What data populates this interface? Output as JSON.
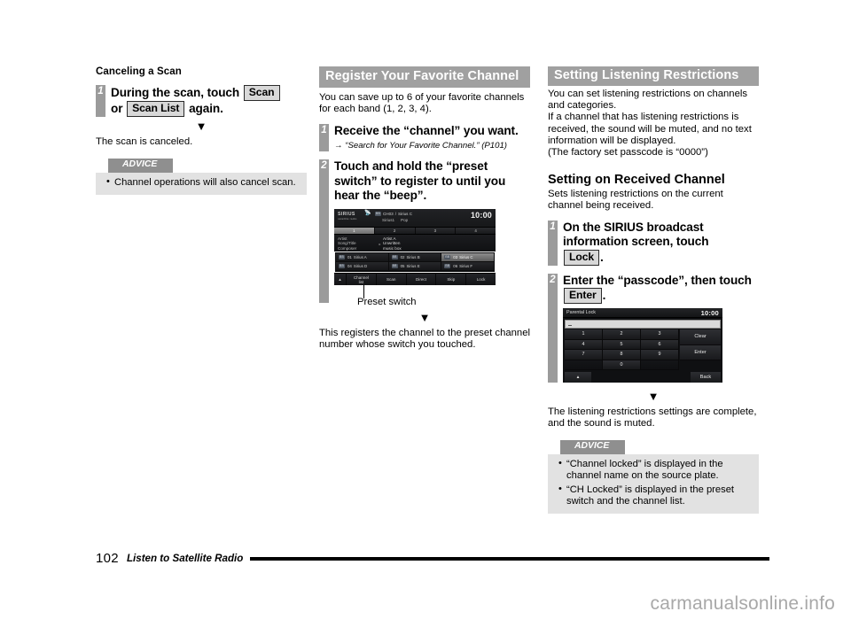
{
  "footer": {
    "page_number": "102",
    "title": "Listen to Satellite Radio"
  },
  "watermark": "carmanualsonline.info",
  "left_column": {
    "subhead": "Canceling a Scan",
    "step1": {
      "num": "1",
      "text_part1": "During the scan, touch",
      "key1": "Scan",
      "text_part2": "or",
      "key2": "Scan List",
      "text_part3": "again."
    },
    "arrow": "▼",
    "result": "The scan is canceled.",
    "advice": {
      "tab": "ADVICE",
      "items": [
        "Channel operations will also cancel scan."
      ]
    }
  },
  "mid_column": {
    "section_title": "Register Your Favorite Channel",
    "intro": "You can save up to 6 of your favorite channels for each band (1, 2, 3, 4).",
    "step1": {
      "num": "1",
      "text": "Receive the “channel” you want.",
      "note": "→ “Search for Your Favorite Channel.” (P101)"
    },
    "step2": {
      "num": "2",
      "text": "Touch and hold the “preset switch” to register to until you hear the “beep”."
    },
    "callout_label": "Preset switch",
    "arrow": "▼",
    "result": "This registers the channel to the preset channel number whose switch you touched."
  },
  "sirius_screen": {
    "logo": "SIRIUS",
    "logo_sub": "satellite radio",
    "satellite_icon": "satellite-dish-icon",
    "channel_badge": "BB",
    "channel_number": "CH03",
    "channel_sep": "/",
    "channel_name": "Sirius C",
    "meta_left": "Sirius1",
    "meta_right": "Pop",
    "clock": "10:00",
    "bands": [
      "1",
      "2",
      "3",
      "4"
    ],
    "active_band_index": 0,
    "info_labels": [
      "Artist",
      "Song/Title",
      "Composer"
    ],
    "info_arrow": "▸",
    "info_values": [
      "Artist A",
      "Unwritten",
      "music box"
    ],
    "presets": [
      {
        "badge": "BB",
        "num": "01",
        "name": "Sirius A",
        "selected": false
      },
      {
        "badge": "BB",
        "num": "02",
        "name": "Sirius B",
        "selected": false
      },
      {
        "badge": "BB",
        "num": "03",
        "name": "Sirius C",
        "selected": true
      },
      {
        "badge": "BB",
        "num": "04",
        "name": "Sirius D",
        "selected": false
      },
      {
        "badge": "BB",
        "num": "05",
        "name": "Sirius E",
        "selected": false
      },
      {
        "badge": "BB",
        "num": "06",
        "name": "Sirius F",
        "selected": false
      }
    ],
    "bottom_buttons": [
      {
        "label": "▴",
        "kind": "caret"
      },
      {
        "label": "Channel",
        "label2": "list",
        "kind": "two"
      },
      {
        "label": "Scan",
        "kind": "one"
      },
      {
        "label": "Direct",
        "kind": "one"
      },
      {
        "label": "Skip",
        "kind": "one"
      },
      {
        "label": "Lock",
        "kind": "one"
      }
    ]
  },
  "right_column": {
    "section_title": "Setting Listening Restrictions",
    "intro_line1": "You can set listening restrictions on channels and categories.",
    "intro_line2": "If a channel that has listening restrictions is received, the sound will be muted, and no text information will be displayed.",
    "intro_line3": "(The factory set passcode is “0000”)",
    "subhead": "Setting on Received Channel",
    "subhead_intro": "Sets listening restrictions on the current channel being received.",
    "step1": {
      "num": "1",
      "text": "On the SIRIUS broadcast information screen, touch",
      "key": "Lock",
      "period": "."
    },
    "step2": {
      "num": "2",
      "text_part1": "Enter the “passcode”, then touch",
      "key": "Enter",
      "period": "."
    },
    "arrow": "▼",
    "result": "The listening restrictions settings are complete, and the sound is muted.",
    "advice": {
      "tab": "ADVICE",
      "items": [
        "“Channel locked” is displayed in the channel name on the source plate.",
        "“CH Locked” is displayed in the preset switch and the channel list."
      ]
    }
  },
  "parental_lock_screen": {
    "title": "Parental Lock",
    "clock": "10:00",
    "entry_value": "",
    "keys": [
      [
        "1",
        "2",
        "3"
      ],
      [
        "4",
        "5",
        "6"
      ],
      [
        "7",
        "8",
        "9"
      ],
      [
        "",
        "0",
        ""
      ]
    ],
    "clear_label": "Clear",
    "enter_label": "Enter",
    "up_label": "▴",
    "back_label": "Back"
  },
  "colors": {
    "section_bar": "#a0a0a0",
    "step_bar": "#9b9b9b",
    "advice_tab": "#8f8f8f",
    "advice_body": "#e2e2e2",
    "key_face": "#d8d8d8"
  }
}
